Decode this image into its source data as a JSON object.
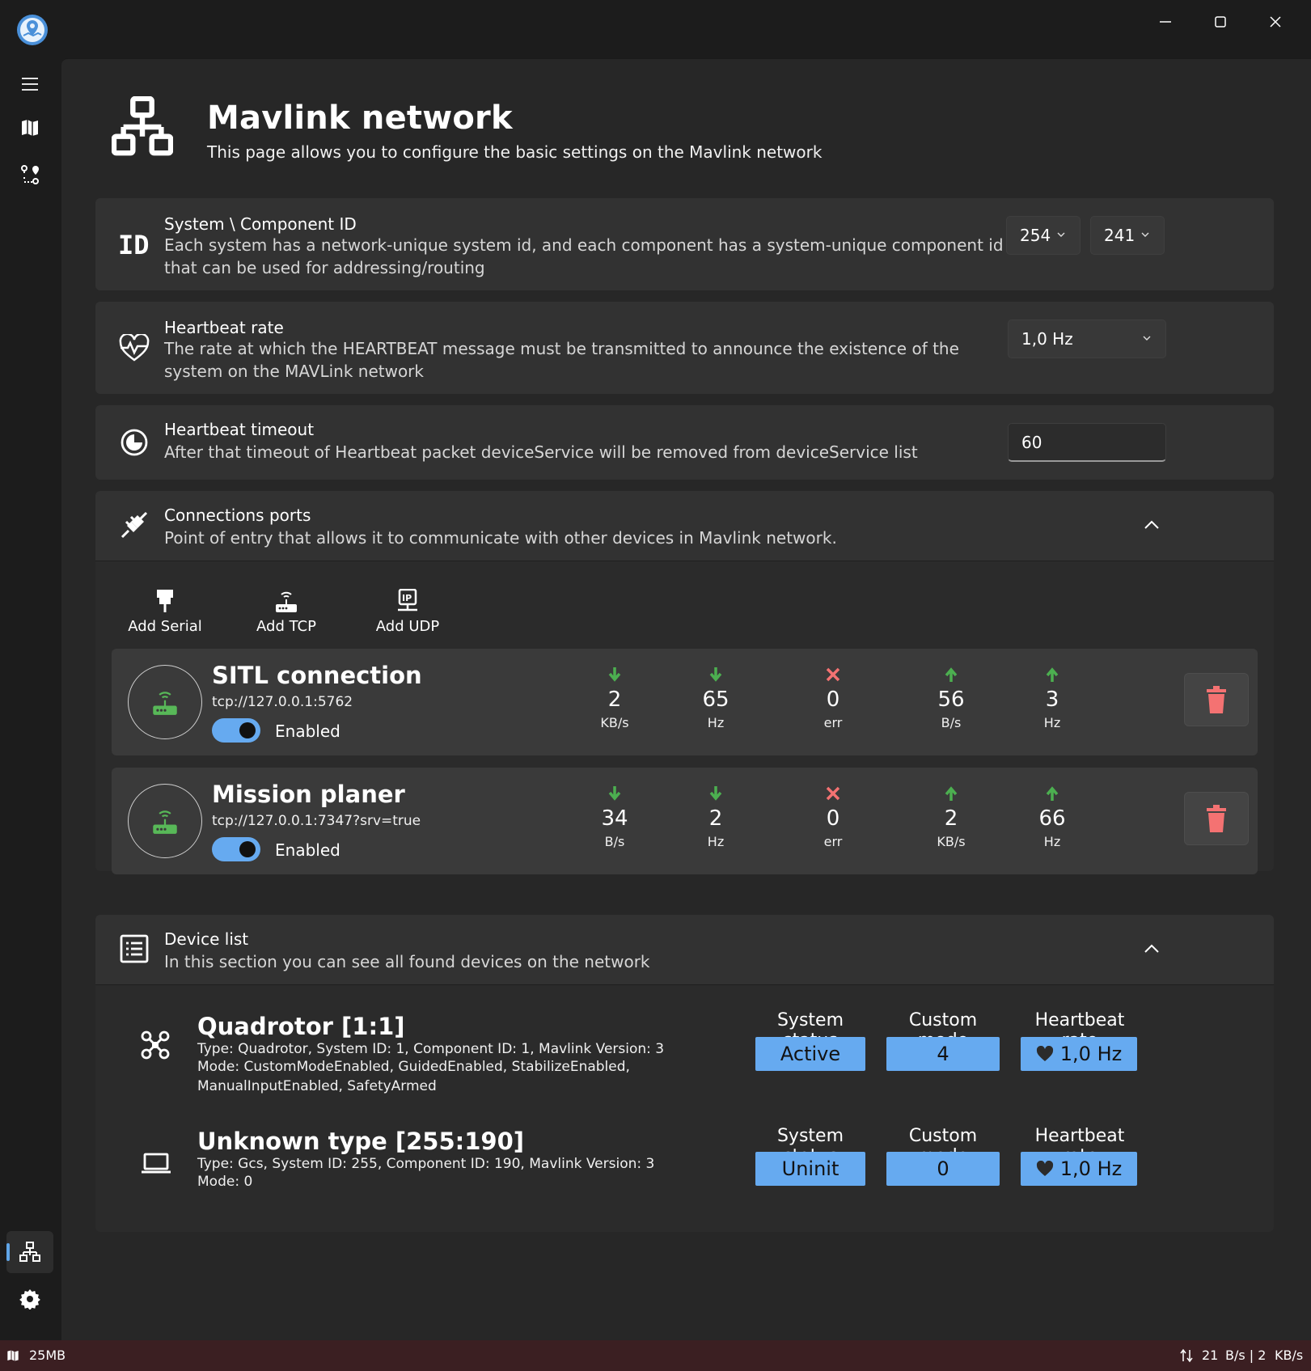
{
  "app": {
    "logo": "map-pin-logo-icon"
  },
  "sidebar": {
    "items": [
      "menu-icon",
      "map-icon",
      "route-icon",
      "network-icon",
      "gear-icon"
    ]
  },
  "window": {
    "minimize": "minimize-icon",
    "maximize": "maximize-icon",
    "close": "close-icon"
  },
  "page": {
    "title": "Mavlink network",
    "subtitle": "This page allows you to configure the basic settings on the Mavlink network"
  },
  "system_id": {
    "title": "System \\ Component ID",
    "desc": "Each system has a network-unique system id, and each component has a system-unique component id that can be used for addressing/routing",
    "system_value": "254",
    "component_value": "241"
  },
  "heartbeat_rate": {
    "title": "Heartbeat rate",
    "desc": "The rate at which the HEARTBEAT message must be transmitted to announce the existence of the system on the MAVLink network",
    "value": "1,0 Hz"
  },
  "heartbeat_timeout": {
    "title": "Heartbeat timeout",
    "desc": "After that timeout of Heartbeat packet deviceService will be removed from deviceService list",
    "value": "60"
  },
  "connections": {
    "title": "Connections ports",
    "desc": "Point of entry that allows it to communicate with other devices in Mavlink network.",
    "add_serial": "Add Serial",
    "add_tcp": "Add TCP",
    "add_udp": "Add UDP",
    "items": [
      {
        "name": "SITL connection",
        "url": "tcp://127.0.0.1:5762",
        "enabled_label": "Enabled",
        "rx_rate": "2",
        "rx_rate_unit": "KB/s",
        "rx_hz": "65",
        "rx_hz_unit": "Hz",
        "err": "0",
        "err_unit": "err",
        "tx_rate": "56",
        "tx_rate_unit": "B/s",
        "tx_hz": "3",
        "tx_hz_unit": "Hz"
      },
      {
        "name": "Mission planer",
        "url": "tcp://127.0.0.1:7347?srv=true",
        "enabled_label": "Enabled",
        "rx_rate": "34",
        "rx_rate_unit": "B/s",
        "rx_hz": "2",
        "rx_hz_unit": "Hz",
        "err": "0",
        "err_unit": "err",
        "tx_rate": "2",
        "tx_rate_unit": "KB/s",
        "tx_hz": "66",
        "tx_hz_unit": "Hz"
      }
    ]
  },
  "devices": {
    "title": "Device list",
    "desc": "In this section you can see all found devices on the network",
    "col_status": "System status",
    "col_mode": "Custom mode",
    "col_rate": "Heartbeat rate",
    "items": [
      {
        "name": "Quadrotor [1:1]",
        "line1": "Type: Quadrotor, System ID: 1, Component ID: 1, Mavlink Version: 3",
        "line2": "Mode: CustomModeEnabled, GuidedEnabled, StabilizeEnabled, ManualInputEnabled, SafetyArmed",
        "status": "Active",
        "mode": "4",
        "rate": "1,0 Hz",
        "icon": "drone-icon"
      },
      {
        "name": "Unknown type [255:190]",
        "line1": "Type: Gcs, System ID: 255, Component ID: 190, Mavlink Version: 3",
        "line2": "Mode: 0",
        "status": "Uninit",
        "mode": "0",
        "rate": "1,0 Hz",
        "icon": "laptop-icon"
      }
    ]
  },
  "statusbar": {
    "memory": "25MB",
    "rx": "21",
    "rx_unit": "B/s | 2",
    "tx_unit": "KB/s"
  },
  "colors": {
    "accent": "#66aaf0",
    "rx_arrow": "#4caf50",
    "err": "#f47272",
    "delete": "#f47272"
  }
}
